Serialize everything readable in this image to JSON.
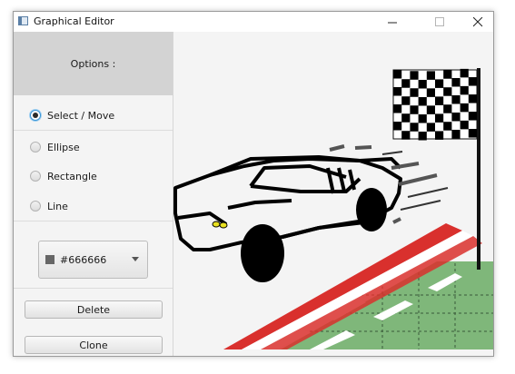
{
  "window": {
    "title": "Graphical Editor"
  },
  "sidebar": {
    "header": "Options :",
    "tools": [
      {
        "label": "Select / Move",
        "selected": true
      },
      {
        "label": "Ellipse",
        "selected": false
      },
      {
        "label": "Rectangle",
        "selected": false
      },
      {
        "label": "Line",
        "selected": false
      }
    ],
    "color_picker": {
      "value": "#666666",
      "swatch_color": "#666666"
    },
    "delete_label": "Delete",
    "clone_label": "Clone"
  },
  "canvas": {
    "drawing": "race car with checkered flag and track"
  }
}
